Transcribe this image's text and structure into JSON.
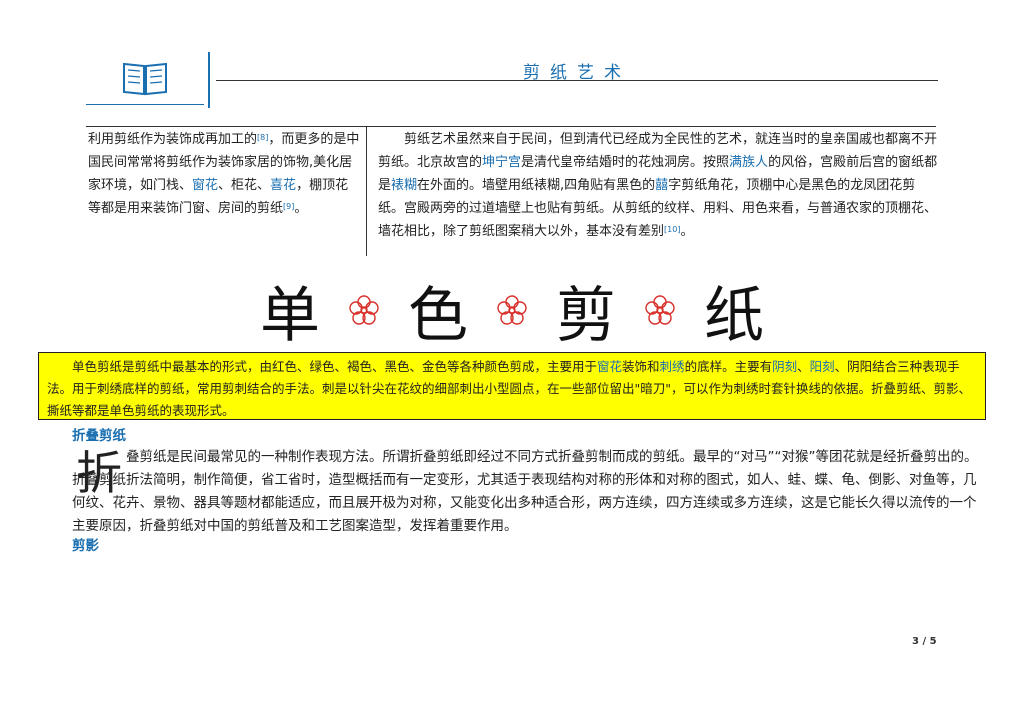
{
  "header": {
    "title": "剪纸艺术",
    "icon": "open-book-icon"
  },
  "left_col": {
    "p1_a": "利用剪纸作为装饰成再加工的",
    "p1_ref1": "[8]",
    "p1_b": "，而更多的是中国民间常常将剪纸作为装饰家居的饰物,美化居家环境，如门栈、",
    "link_window": "窗花",
    "p1_c": "、柜花、",
    "link_xi": "喜花",
    "p1_d": "，棚顶花等都是用来装饰门窗、房间的剪纸",
    "p1_ref2": "[9]",
    "p1_e": "。"
  },
  "right_col": {
    "a": "剪纸艺术虽然来自于民间，但到清代已经成为全民性的艺术，就连当时的皇亲国戚也都离不开剪纸。北京故宫的",
    "link_kunning": "坤宁宫",
    "b": "是清代皇帝结婚时的花烛洞房。按照",
    "link_manchu": "满族人",
    "c": "的风俗，宫殿前后宫的窗纸都是",
    "link_biaohu": "裱糊",
    "d": "在外面的。墙壁用纸裱糊,四角贴有黑色的",
    "link_xi": "囍",
    "e": "字剪纸角花，顶棚中心是黑色的龙凤团花剪纸。宫殿两旁的过道墙壁上也贴有剪纸。从剪纸的纹样、用料、用色来看，与普通农家的顶棚花、墙花相比，除了剪纸图案稍大以外，基本没有差别",
    "ref": "[10]",
    "f": "。"
  },
  "big_title": {
    "c1": "单",
    "c2": "色",
    "c3": "剪",
    "c4": "纸",
    "ornament": "flower-ornament-icon"
  },
  "yellow_box": {
    "a": "单色剪纸是剪纸中最基本的形式，由红色、绿色、褐色、黑色、金色等各种颜色剪成，主要用于",
    "link_window": "窗花",
    "b": "装饰和",
    "link_embroidery": "刺绣",
    "c": "的底样。主要有",
    "link_yinke": "阴刻",
    "d": "、",
    "link_yangke": "阳刻",
    "e": "、阴阳结合三种表现手法。用于刺绣底样的剪纸，常用剪刺结合的手法。刺是以针尖在花纹的细部刺出小型圆点，在一些部位留出\"暗刀\"，可以作为刺绣时套针换线的依据。折叠剪纸、剪影、撕纸等都是单色剪纸的表现形式。"
  },
  "fold": {
    "heading": "折叠剪纸",
    "dropcap": "折",
    "text": "叠剪纸是民间最常见的一种制作表现方法。所谓折叠剪纸即经过不同方式折叠剪制而成的剪纸。最早的“对马”“对猴”等团花就是经折叠剪出的。折叠剪纸折法简明，制作简便，省工省时，造型概括而有一定变形，尤其适于表现结构对称的形体和对称的图式，如人、蛙、蝶、龟、倒影、对鱼等，几何纹、花卉、景物、器具等题材都能适应，而且展开极为对称，又能变化出多种适合形，两方连续，四方连续或多方连续，这是它能长久得以流传的一个主要原因，折叠剪纸对中国的剪纸普及和工艺图案造型，发挥着重要作用。"
  },
  "silhouette": {
    "heading": "剪影"
  },
  "page": {
    "number": "3 / 5"
  },
  "colors": {
    "accent": "#1a6fb0",
    "highlight": "#ffff00",
    "ornament": "#d9302c"
  }
}
